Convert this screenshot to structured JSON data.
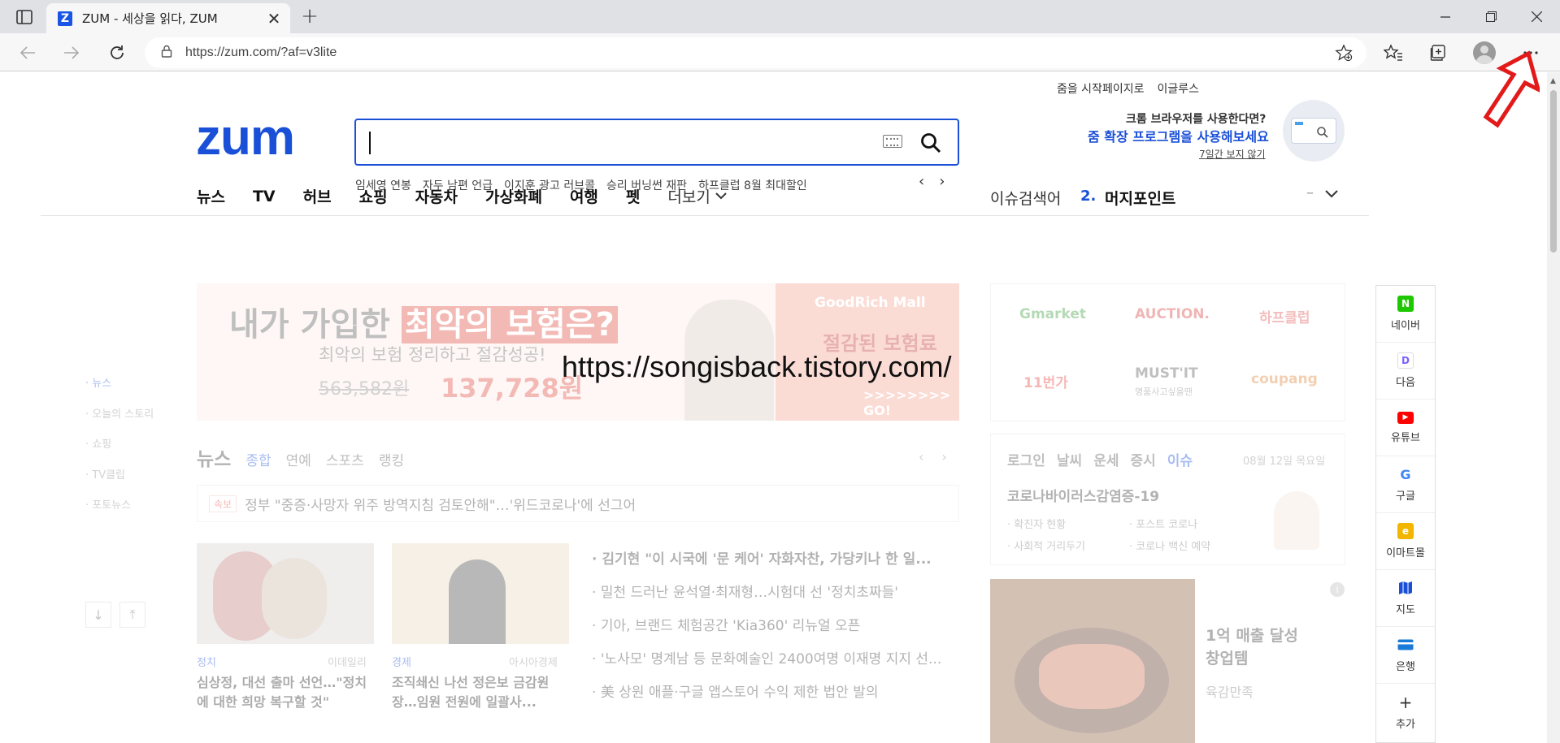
{
  "browser": {
    "tab_title": "ZUM - 세상을 읽다, ZUM",
    "tab_favicon": "Z",
    "url": "https://zum.com/?af=v3lite",
    "icons": [
      "sidebar-toggle-icon",
      "close-icon",
      "plus-icon",
      "minimize-icon",
      "restore-icon",
      "back-icon",
      "forward-icon",
      "refresh-icon",
      "lock-icon",
      "add-favorite-icon",
      "favorites-icon",
      "collections-icon",
      "profile-avatar",
      "more-menu-icon"
    ]
  },
  "header": {
    "util_links": [
      "줌을 시작페이지로",
      "이글루스"
    ],
    "logo": "zum",
    "trending": [
      "임세영 연봉",
      "자두 남편 언급",
      "이지훈 광고 러브콜",
      "승리 버닝썬 재판",
      "하프클럽 8월 최대할인"
    ],
    "promo": {
      "line1": "크롬 브라우저를 사용한다면?",
      "line2": "줌 확장 프로그램을 사용해보세요",
      "hide": "7일간 보지 않기"
    }
  },
  "gnb": {
    "items": [
      "뉴스",
      "TV",
      "허브",
      "쇼핑",
      "자동차",
      "가상화폐",
      "여행",
      "펫"
    ],
    "more": "더보기",
    "issue_label": "이슈검색어",
    "issue_rank": "2.",
    "issue_word": "머지포인트"
  },
  "banner": {
    "headline_prefix": "내가 가입한",
    "headline_highlight": "최악의 보험은?",
    "sub": "최악의 보험 정리하고 절감성공!",
    "old_price": "563,582원",
    "new_price": "137,728원",
    "brand": "GoodRich Mall",
    "insurance": "절감된 보험료",
    "go": ">>>>>>>> GO!"
  },
  "watermark": "https://songisback.tistory.com/",
  "shopping": [
    {
      "name": "Gmarket",
      "color": "#3a9a3a"
    },
    {
      "name": "AUCTION.",
      "color": "#d83b3b"
    },
    {
      "name": "하프클럽",
      "color": "#e05050"
    },
    {
      "name": "11번가",
      "color": "#e84040"
    },
    {
      "name": "MUST'IT",
      "color": "#555555"
    },
    {
      "name": "coupang",
      "color": "#e08030"
    }
  ],
  "shopping_sub": "명품사고싶을땐",
  "side_nav": [
    "뉴스",
    "오늘의 스토리",
    "쇼핑",
    "TV클립",
    "포토뉴스"
  ],
  "news": {
    "title": "뉴스",
    "tabs": [
      "종합",
      "연예",
      "스포츠",
      "랭킹"
    ],
    "breaking_tag": "속보",
    "breaking": "정부 \"중증·사망자 위주 방역지침 검토안해\"…'위드코로나'에 선그어",
    "cards": [
      {
        "category": "정치",
        "source": "이데일리",
        "title": "심상정, 대선 출마 선언…\"정치에 대한 희망 복구할 것\""
      },
      {
        "category": "경제",
        "source": "아시아경제",
        "title": "조직쇄신 나선 정은보 금감원장…임원 전원에 일괄사..."
      }
    ],
    "headlines": [
      "김기현 \"이 시국에 '문 케어' 자화자찬, 가당키나 한 일...",
      "밀천 드러난 윤석열·최재형…시험대 선 '정치초짜들'",
      "기아, 브랜드 체험공간 'Kia360' 리뉴얼 오픈",
      "'노사모' 명계남 등 문화예술인 2400여명 이재명 지지 선...",
      "美 상원 애플·구글 앱스토어 수익 제한 법안 발의"
    ]
  },
  "info": {
    "tabs": [
      "로그인",
      "날씨",
      "운세",
      "증시",
      "이슈"
    ],
    "date": "08월 12일 목요일",
    "title": "코로나바이러스감염증-19",
    "links": [
      "확진자 현황",
      "포스트 코로나",
      "사회적 거리두기",
      "코로나 백신 예약"
    ]
  },
  "ad": {
    "title_line1": "1억 매출 달성",
    "title_line2": "창업템",
    "sub": "육감만족"
  },
  "quick_links": [
    {
      "label": "네이버",
      "glyph": "N",
      "color": "#1ec800"
    },
    {
      "label": "다음",
      "glyph": "D",
      "color": "#7b61ff"
    },
    {
      "label": "유튜브",
      "glyph": "▶",
      "color": "#ff0000"
    },
    {
      "label": "구글",
      "glyph": "G",
      "color": "#4285f4"
    },
    {
      "label": "이마트몰",
      "glyph": "e",
      "color": "#f2b600"
    },
    {
      "label": "지도",
      "glyph": "▮",
      "color": "#1a4fd8"
    },
    {
      "label": "은행",
      "glyph": "▬",
      "color": "#1a7ad8"
    },
    {
      "label": "추가",
      "glyph": "+",
      "color": "#ffffff"
    }
  ]
}
